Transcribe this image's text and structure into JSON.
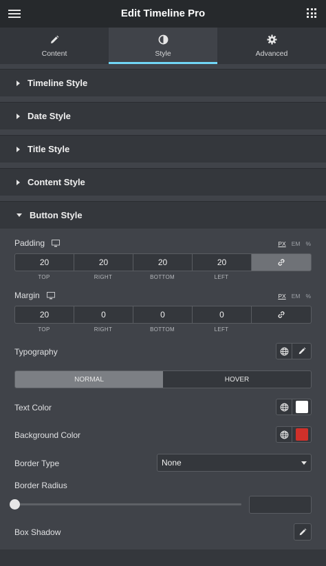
{
  "header": {
    "title": "Edit Timeline Pro",
    "menu_icon": "hamburger-icon",
    "apps_icon": "grid-icon"
  },
  "tabs": [
    {
      "label": "Content",
      "icon": "pencil-icon",
      "active": false
    },
    {
      "label": "Style",
      "icon": "half-circle-icon",
      "active": true
    },
    {
      "label": "Advanced",
      "icon": "gear-icon",
      "active": false
    }
  ],
  "sections": [
    {
      "label": "Timeline Style",
      "open": false
    },
    {
      "label": "Date Style",
      "open": false
    },
    {
      "label": "Title Style",
      "open": false
    },
    {
      "label": "Content Style",
      "open": false
    },
    {
      "label": "Button Style",
      "open": true
    }
  ],
  "units": [
    "PX",
    "EM",
    "%"
  ],
  "padding": {
    "label": "Padding",
    "values": [
      "20",
      "20",
      "20",
      "20"
    ],
    "sides": [
      "TOP",
      "RIGHT",
      "BOTTOM",
      "LEFT"
    ],
    "linked": true
  },
  "margin": {
    "label": "Margin",
    "values": [
      "20",
      "0",
      "0",
      "0"
    ],
    "sides": [
      "TOP",
      "RIGHT",
      "BOTTOM",
      "LEFT"
    ],
    "linked": false
  },
  "typography": {
    "label": "Typography"
  },
  "state_toggle": {
    "normal": "NORMAL",
    "hover": "HOVER",
    "selected": "NORMAL"
  },
  "text_color": {
    "label": "Text Color",
    "value": "#ffffff"
  },
  "background_color": {
    "label": "Background Color",
    "value": "#d0302a"
  },
  "border_type": {
    "label": "Border Type",
    "value": "None"
  },
  "border_radius": {
    "label": "Border Radius",
    "value": ""
  },
  "box_shadow": {
    "label": "Box Shadow"
  },
  "colors": {
    "accent": "#71d7f7",
    "panel": "#404349",
    "section": "#34373c",
    "topbar": "#26292c"
  }
}
